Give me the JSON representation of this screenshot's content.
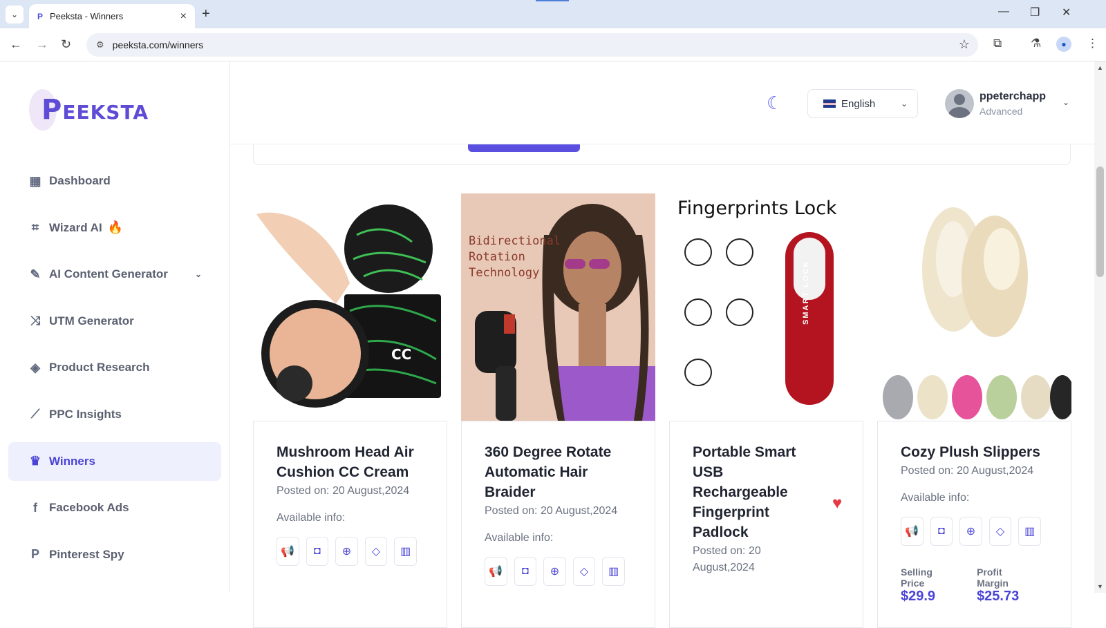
{
  "browser": {
    "tab_title": "Peeksta - Winners",
    "tab_favicon": "P",
    "url": "peeksta.com/winners"
  },
  "sidebar": {
    "logo": "PEEKSTA",
    "items": [
      {
        "label": "Dashboard",
        "icon": "dashboard-icon"
      },
      {
        "label": "Wizard AI",
        "icon": "chip-icon"
      },
      {
        "label": "AI Content Generator",
        "icon": "magic-wand-icon"
      },
      {
        "label": "UTM Generator",
        "icon": "shuffle-icon"
      },
      {
        "label": "Product Research",
        "icon": "layers-icon"
      },
      {
        "label": "PPC Insights",
        "icon": "line-chart-icon"
      },
      {
        "label": "Winners",
        "icon": "trophy-icon"
      },
      {
        "label": "Facebook Ads",
        "icon": "facebook-icon"
      },
      {
        "label": "Pinterest Spy",
        "icon": "pinterest-icon"
      }
    ]
  },
  "header": {
    "language": "English",
    "user_name": "ppeterchapp",
    "user_plan": "Advanced"
  },
  "products": [
    {
      "title": "Mushroom Head Air Cushion CC Cream",
      "posted": "Posted on: 20 August,2024",
      "available": "Available info:",
      "favorite": false
    },
    {
      "title": "360 Degree Rotate Automatic Hair Braider",
      "posted": "Posted on: 20 August,2024",
      "available": "Available info:",
      "favorite": false,
      "image_text": [
        "Bidirectional",
        "Rotation",
        "Technology"
      ]
    },
    {
      "title": "Portable Smart USB Rechargeable Fingerprint Padlock",
      "posted": "Posted on: 20 August,2024",
      "available": "Available info:",
      "favorite": true,
      "image_text": [
        "Fingerprints Lock",
        "SMART LOCK"
      ]
    },
    {
      "title": "Cozy Plush Slippers",
      "posted": "Posted on: 20 August,2024",
      "available": "Available info:",
      "favorite": false,
      "selling_price_label": "Selling Price",
      "selling_price": "$29.9",
      "profit_margin_label": "Profit Margin",
      "profit_margin": "$25.73"
    }
  ],
  "info_icons": [
    "megaphone-icon",
    "shopping-bag-icon",
    "target-icon",
    "price-tag-icon",
    "bar-chart-icon"
  ],
  "colors": {
    "accent": "#4a44d6",
    "active_bg": "#eef0fe",
    "favorite": "#e53946"
  }
}
